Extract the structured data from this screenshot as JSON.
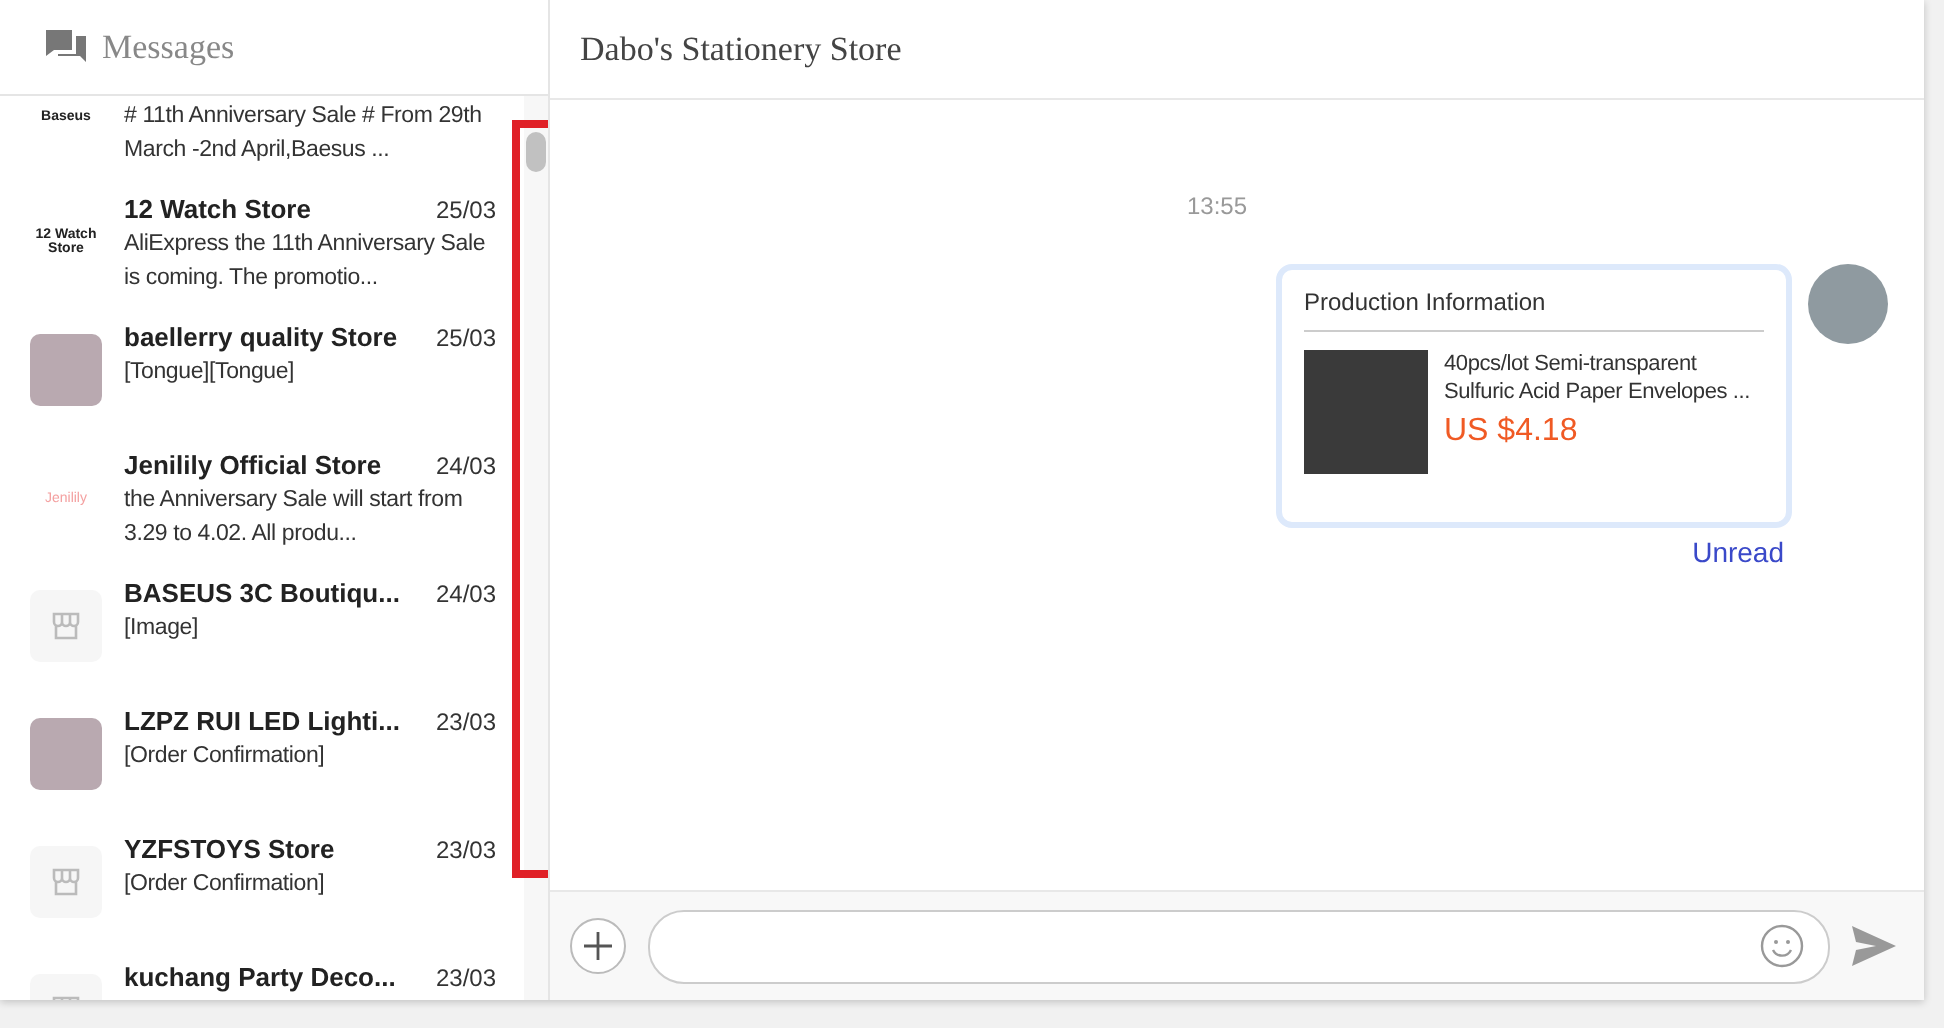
{
  "sidebar": {
    "title": "Messages",
    "conversations": [
      {
        "avatar": {
          "kind": "logo",
          "text": "Baseus"
        },
        "preview": "# 11th Anniversary Sale # From 29th March -2nd April,Baesus ..."
      },
      {
        "avatar": {
          "kind": "logo",
          "text": "12 Watch Store"
        },
        "name": "12 Watch Store",
        "date": "25/03",
        "preview": "AliExpress the 11th Anniversary Sale is coming. The promotio..."
      },
      {
        "avatar": {
          "kind": "photo"
        },
        "name": "baellerry quality Store",
        "date": "25/03",
        "preview": "[Tongue][Tongue]"
      },
      {
        "avatar": {
          "kind": "faint-logo",
          "text": "Jenilily"
        },
        "name": "Jenilily Official Store",
        "date": "24/03",
        "preview": "the Anniversary Sale will start from 3.29 to 4.02. All produ..."
      },
      {
        "avatar": {
          "kind": "store"
        },
        "name": "BASEUS 3C Boutiqu...",
        "date": "24/03",
        "preview": "[Image]"
      },
      {
        "avatar": {
          "kind": "photo"
        },
        "name": "LZPZ RUI LED Lighti...",
        "date": "23/03",
        "preview": "[Order Confirmation]"
      },
      {
        "avatar": {
          "kind": "store"
        },
        "name": "YZFSTOYS Store",
        "date": "23/03",
        "preview": "[Order Confirmation]"
      },
      {
        "avatar": {
          "kind": "store"
        },
        "name": "kuchang Party Deco...",
        "date": "23/03"
      }
    ]
  },
  "chat": {
    "title": "Dabo's Stationery Store",
    "time": "13:55",
    "card": {
      "heading": "Production Information",
      "product": "40pcs/lot Semi-transparent Sulfuric Acid Paper Envelopes ...",
      "price": "US $4.18"
    },
    "status": "Unread"
  }
}
